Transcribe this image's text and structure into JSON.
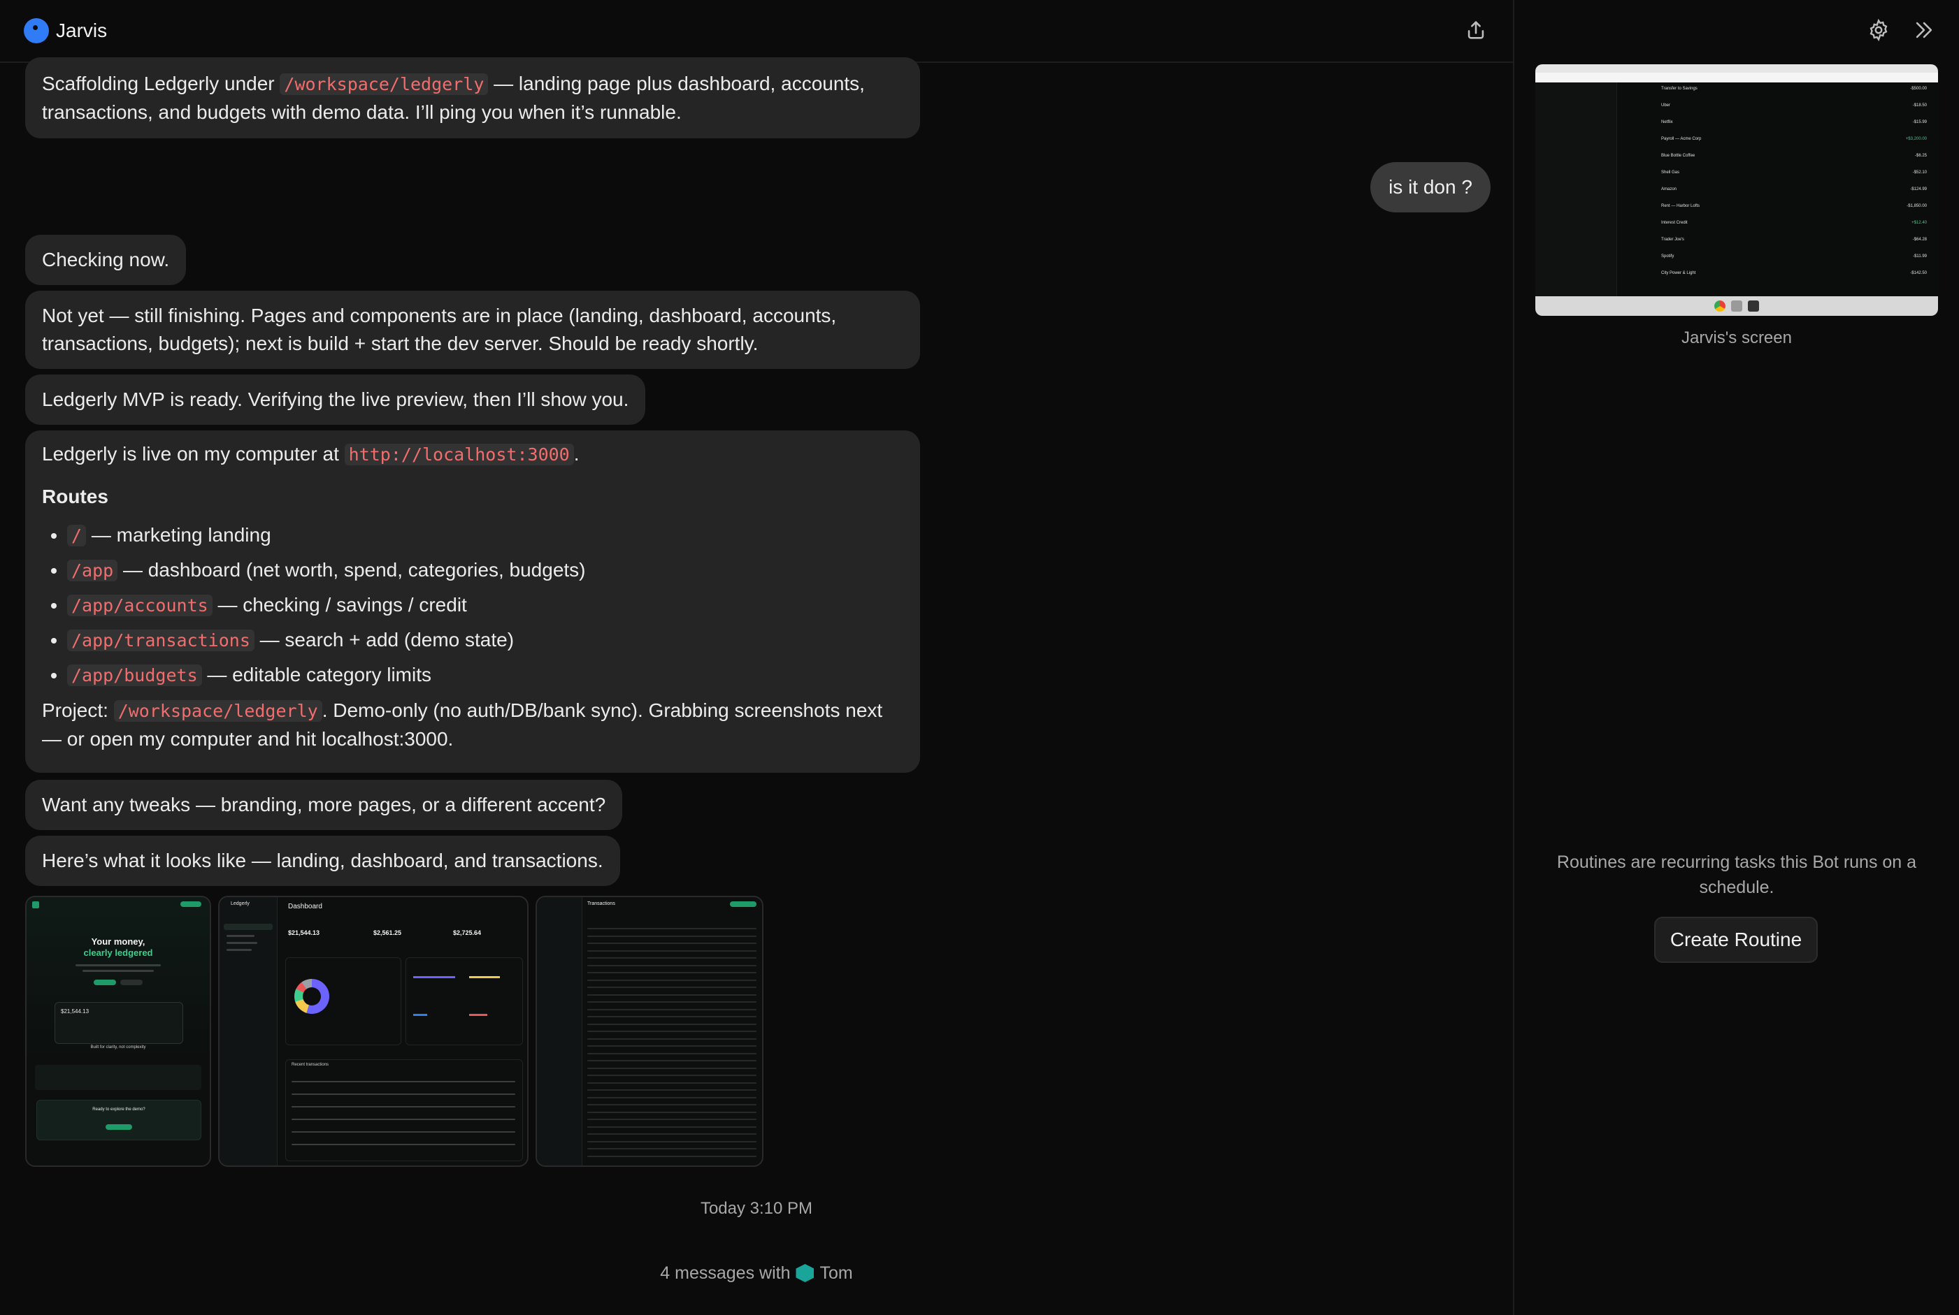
{
  "header": {
    "title": "Jarvis"
  },
  "messages": {
    "m1": {
      "before": "Scaffolding Ledgerly under ",
      "code": "/workspace/ledgerly",
      "after": " — landing page plus dashboard, accounts, transactions, and budgets with demo data. I’ll ping you when it’s runnable."
    },
    "user": "is it don ?",
    "m2": "Checking now.",
    "m3": "Not yet — still finishing. Pages and components are in place (landing, dashboard, accounts, transactions, budgets); next is build + start the dev server. Should be ready shortly.",
    "m4": "Ledgerly MVP is ready. Verifying the live preview, then I’ll show you.",
    "m5": {
      "intro_before": "Ledgerly is live on my computer at ",
      "intro_code": "http://localhost:3000",
      "intro_after": ".",
      "heading": "Routes",
      "routes": [
        {
          "code": "/",
          "text": " — marketing landing"
        },
        {
          "code": "/app",
          "text": " — dashboard (net worth, spend, categories, budgets)"
        },
        {
          "code": "/app/accounts",
          "text": " — checking / savings / credit"
        },
        {
          "code": "/app/transactions",
          "text": " — search + add (demo state)"
        },
        {
          "code": "/app/budgets",
          "text": " — editable category limits"
        }
      ],
      "project_before": "Project: ",
      "project_code": "/workspace/ledgerly",
      "project_after": ". Demo-only (no auth/DB/bank sync). Grabbing screenshots next — or open my computer and hit localhost:3000."
    },
    "m6": "Want any tweaks — branding, more pages, or a different accent?",
    "m7": "Here’s what it looks like — landing, dashboard, and transactions."
  },
  "thumbnails": {
    "landing": {
      "headline1": "Your money,",
      "headline2": "clearly ledgered",
      "amount": "$21,544.13",
      "section": "Built for clarity, not complexity",
      "cta": "Ready to explore the demo?"
    },
    "dashboard": {
      "brand": "Ledgerly",
      "title": "Dashboard",
      "stat1": "$21,544.13",
      "stat2": "$2,561.25",
      "stat3": "$2,725.64",
      "section": "Recent transactions"
    },
    "transactions": {
      "title": "Transactions"
    }
  },
  "timestamp": "Today 3:10 PM",
  "footer": {
    "text": "4 messages with",
    "name": "Tom"
  },
  "sidebar": {
    "screen_caption": "Jarvis's screen",
    "routine_text": "Routines are recurring tasks this Bot runs on a schedule.",
    "create_button": "Create Routine"
  },
  "screen_rows": [
    {
      "name": "Transfer to Savings",
      "amount": "-$500.00"
    },
    {
      "name": "Uber",
      "amount": "-$18.50"
    },
    {
      "name": "Netflix",
      "amount": "-$15.99"
    },
    {
      "name": "Payroll — Acme Corp",
      "amount": "+$3,200.00"
    },
    {
      "name": "Blue Bottle Coffee",
      "amount": "-$6.25"
    },
    {
      "name": "Shell Gas",
      "amount": "-$52.10"
    },
    {
      "name": "Amazon",
      "amount": "-$124.99"
    },
    {
      "name": "Rent — Harbor Lofts",
      "amount": "-$1,850.00"
    },
    {
      "name": "Interest Credit",
      "amount": "+$12.40"
    },
    {
      "name": "Trader Joe's",
      "amount": "-$64.28"
    },
    {
      "name": "Spotify",
      "amount": "-$11.99"
    },
    {
      "name": "City Power & Light",
      "amount": "-$142.50"
    }
  ]
}
